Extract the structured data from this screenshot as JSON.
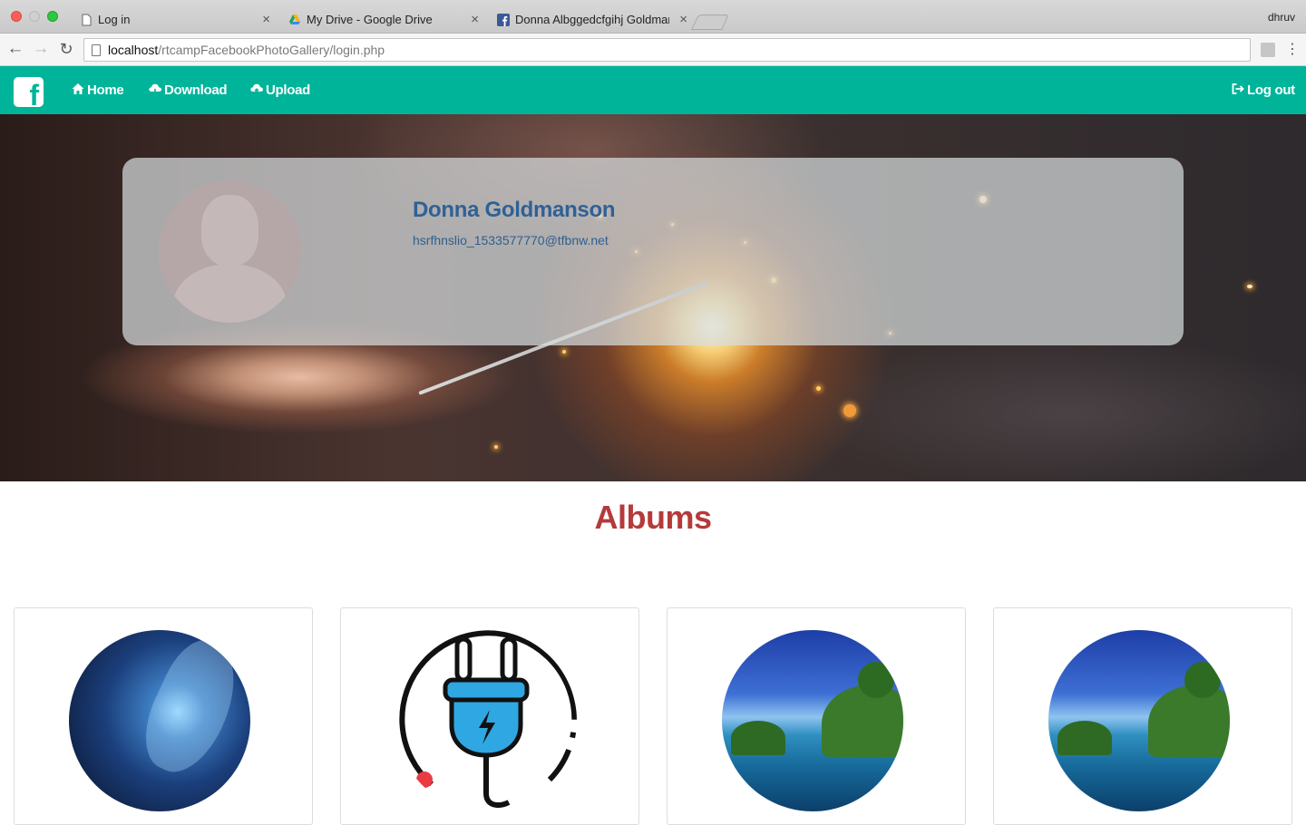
{
  "browser": {
    "tabs": [
      {
        "title": "Log in",
        "active": true
      },
      {
        "title": "My Drive - Google Drive",
        "active": false
      },
      {
        "title": "Donna Albggedcfgihj Goldman",
        "active": false
      }
    ],
    "profile_name": "dhruv",
    "url_host": "localhost",
    "url_path": "/rtcampFacebookPhotoGallery/login.php"
  },
  "navbar": {
    "brand_icon": "facebook-logo",
    "home_label": "Home",
    "download_label": "Download",
    "upload_label": "Upload",
    "logout_label": "Log out",
    "accent_color": "#00b49a"
  },
  "profile": {
    "name": "Donna Goldmanson",
    "email": "hsrfhnslio_1533577770@tfbnw.net"
  },
  "albums": {
    "title": "Albums",
    "title_color": "#b53a3a",
    "items": [
      {
        "thumb": "dragon-image"
      },
      {
        "thumb": "electric-plug-icon"
      },
      {
        "thumb": "island-image"
      },
      {
        "thumb": "island-image"
      }
    ]
  }
}
